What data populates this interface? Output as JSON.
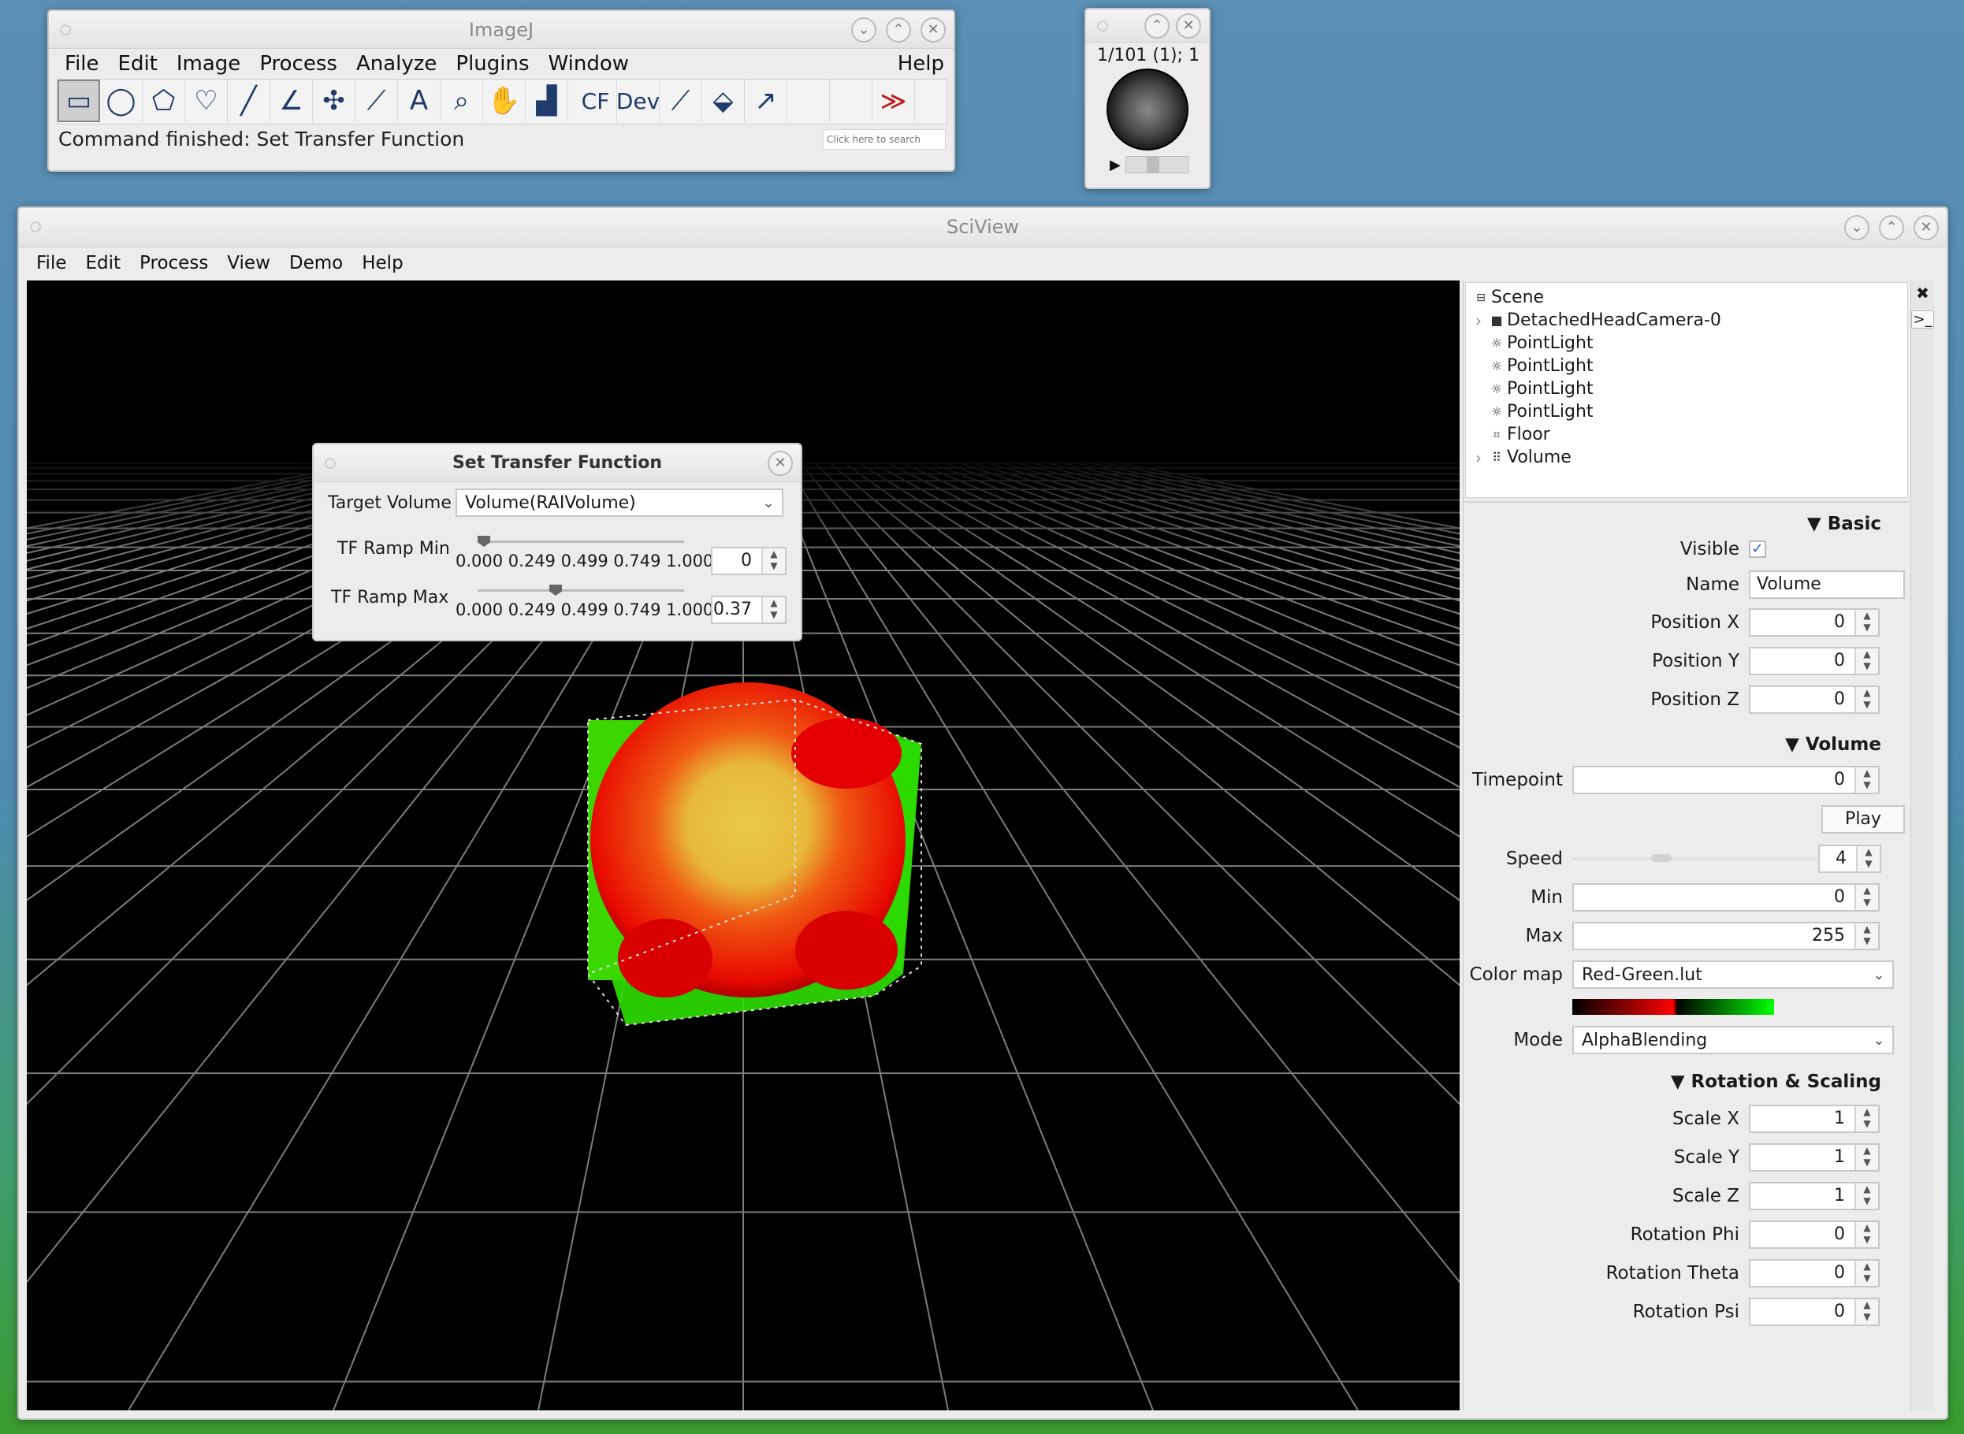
{
  "imagej": {
    "title": "ImageJ",
    "menu": [
      "File",
      "Edit",
      "Image",
      "Process",
      "Analyze",
      "Plugins",
      "Window",
      "Help"
    ],
    "tools": [
      {
        "icon": "rectangle-select-icon",
        "glyph": "▭"
      },
      {
        "icon": "oval-select-icon",
        "glyph": "◯"
      },
      {
        "icon": "polygon-select-icon",
        "glyph": "⬠"
      },
      {
        "icon": "freehand-select-icon",
        "glyph": "♡"
      },
      {
        "icon": "line-tool-icon",
        "glyph": "╱"
      },
      {
        "icon": "angle-tool-icon",
        "glyph": "∠"
      },
      {
        "icon": "multipoint-tool-icon",
        "glyph": "✣"
      },
      {
        "icon": "wand-tool-icon",
        "glyph": "⟋"
      },
      {
        "icon": "text-tool-icon",
        "glyph": "A"
      },
      {
        "icon": "magnifier-icon",
        "glyph": "⌕"
      },
      {
        "icon": "hand-tool-icon",
        "glyph": "✋"
      },
      {
        "icon": "color-picker-icon",
        "glyph": "▟"
      }
    ],
    "extra_tools": [
      {
        "icon": "cf-tool-icon",
        "glyph": "CF"
      },
      {
        "icon": "dev-tool-icon",
        "glyph": "Dev"
      },
      {
        "icon": "brush-tool-icon",
        "glyph": "⟋"
      },
      {
        "icon": "flood-fill-icon",
        "glyph": "⬙"
      },
      {
        "icon": "arrow-tool-icon",
        "glyph": "↗"
      },
      {
        "icon": "empty-slot-icon",
        "glyph": ""
      },
      {
        "icon": "empty-slot-icon",
        "glyph": ""
      },
      {
        "icon": "more-tools-icon",
        "glyph": "≫"
      }
    ],
    "status": "Command finished: Set Transfer Function",
    "search_placeholder": "Click here to search"
  },
  "stack_window": {
    "label": "1/101 (1); 1"
  },
  "sciview": {
    "title": "SciView",
    "menu": [
      "File",
      "Edit",
      "Process",
      "View",
      "Demo",
      "Help"
    ],
    "tree": {
      "root": "Scene",
      "nodes": [
        {
          "label": "DetachedHeadCamera-0",
          "icon": "camera-icon",
          "glyph": "■",
          "expander": "›"
        },
        {
          "label": "PointLight",
          "icon": "light-icon",
          "glyph": "☼",
          "expander": ""
        },
        {
          "label": "PointLight",
          "icon": "light-icon",
          "glyph": "☼",
          "expander": ""
        },
        {
          "label": "PointLight",
          "icon": "light-icon",
          "glyph": "☼",
          "expander": ""
        },
        {
          "label": "PointLight",
          "icon": "light-icon",
          "glyph": "☼",
          "expander": ""
        },
        {
          "label": "Floor",
          "icon": "floor-icon",
          "glyph": "⌗",
          "expander": ""
        },
        {
          "label": "Volume",
          "icon": "volume-icon",
          "glyph": "⠿",
          "expander": "›"
        }
      ]
    },
    "sections": {
      "basic": "▼ Basic",
      "volume": "▼ Volume",
      "rotation": "▼ Rotation & Scaling"
    },
    "props": {
      "visible_label": "Visible",
      "visible": true,
      "name_label": "Name",
      "name_value": "Volume",
      "position": [
        {
          "label": "Position X",
          "value": "0"
        },
        {
          "label": "Position Y",
          "value": "0"
        },
        {
          "label": "Position Z",
          "value": "0"
        }
      ],
      "timepoint_label": "Timepoint",
      "timepoint_value": "0",
      "play_label": "Play",
      "speed_label": "Speed",
      "speed_value": "4",
      "min_label": "Min",
      "min_value": "0",
      "max_label": "Max",
      "max_value": "255",
      "colormap_label": "Color map",
      "colormap_value": "Red-Green.lut",
      "mode_label": "Mode",
      "mode_value": "AlphaBlending",
      "scaling": [
        {
          "label": "Scale X",
          "value": "1"
        },
        {
          "label": "Scale Y",
          "value": "1"
        },
        {
          "label": "Scale Z",
          "value": "1"
        },
        {
          "label": "Rotation Phi",
          "value": "0"
        },
        {
          "label": "Rotation Theta",
          "value": "0"
        },
        {
          "label": "Rotation Psi",
          "value": "0"
        }
      ]
    }
  },
  "tf_dialog": {
    "title": "Set Transfer Function",
    "target_label": "Target Volume",
    "target_value": "Volume(RAIVolume)",
    "ramp_min_label": "TF Ramp Min",
    "ramp_min_value": "0",
    "ramp_max_label": "TF Ramp Max",
    "ramp_max_value": "0.37",
    "ticks": "0.000 0.249 0.499 0.749 1.000",
    "ramp_min_fraction": 0.0,
    "ramp_max_fraction": 0.37
  },
  "colors": {
    "viewport_bg": "#000000",
    "grid": "#8a8a8a",
    "volume_red": "#ff1a00",
    "volume_green": "#2fe000",
    "volume_core": "#e8c23a"
  }
}
